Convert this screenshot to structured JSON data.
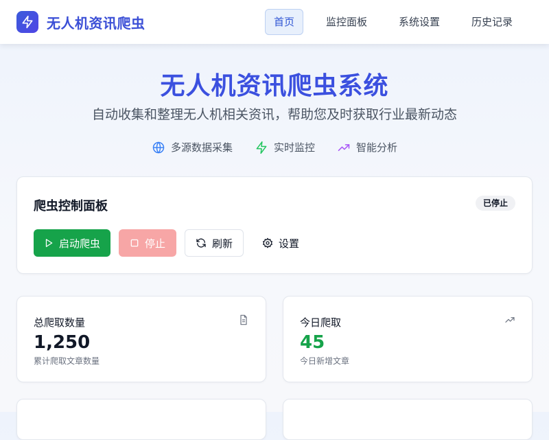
{
  "brand": {
    "name": "无人机资讯爬虫",
    "icon": "lightning-icon",
    "color": "#3b4fd6"
  },
  "nav": {
    "items": [
      {
        "label": "首页",
        "active": true
      },
      {
        "label": "监控面板",
        "active": false
      },
      {
        "label": "系统设置",
        "active": false
      },
      {
        "label": "历史记录",
        "active": false
      }
    ]
  },
  "hero": {
    "title": "无人机资讯爬虫系统",
    "subtitle": "自动收集和整理无人机相关资讯，帮助您及时获取行业最新动态",
    "features": [
      {
        "label": "多源数据采集",
        "icon": "globe-icon",
        "color": "#3b82f6"
      },
      {
        "label": "实时监控",
        "icon": "lightning-icon",
        "color": "#22c55e"
      },
      {
        "label": "智能分析",
        "icon": "trending-up-icon",
        "color": "#a855f7"
      }
    ]
  },
  "control_panel": {
    "title": "爬虫控制面板",
    "status": "已停止",
    "buttons": {
      "start": "启动爬虫",
      "stop": "停止",
      "refresh": "刷新",
      "settings": "设置"
    }
  },
  "stats": [
    {
      "label": "总爬取数量",
      "value": "1,250",
      "desc": "累计爬取文章数量",
      "icon": "document-icon"
    },
    {
      "label": "今日爬取",
      "value": "45",
      "desc": "今日新增文章",
      "icon": "trending-up-icon",
      "value_color": "#16a34a"
    }
  ],
  "colors": {
    "primary": "#3b50df",
    "success": "#16a34a",
    "stop_disabled": "#f7a6a6",
    "nav_active_bg": "#e8f0fc"
  }
}
